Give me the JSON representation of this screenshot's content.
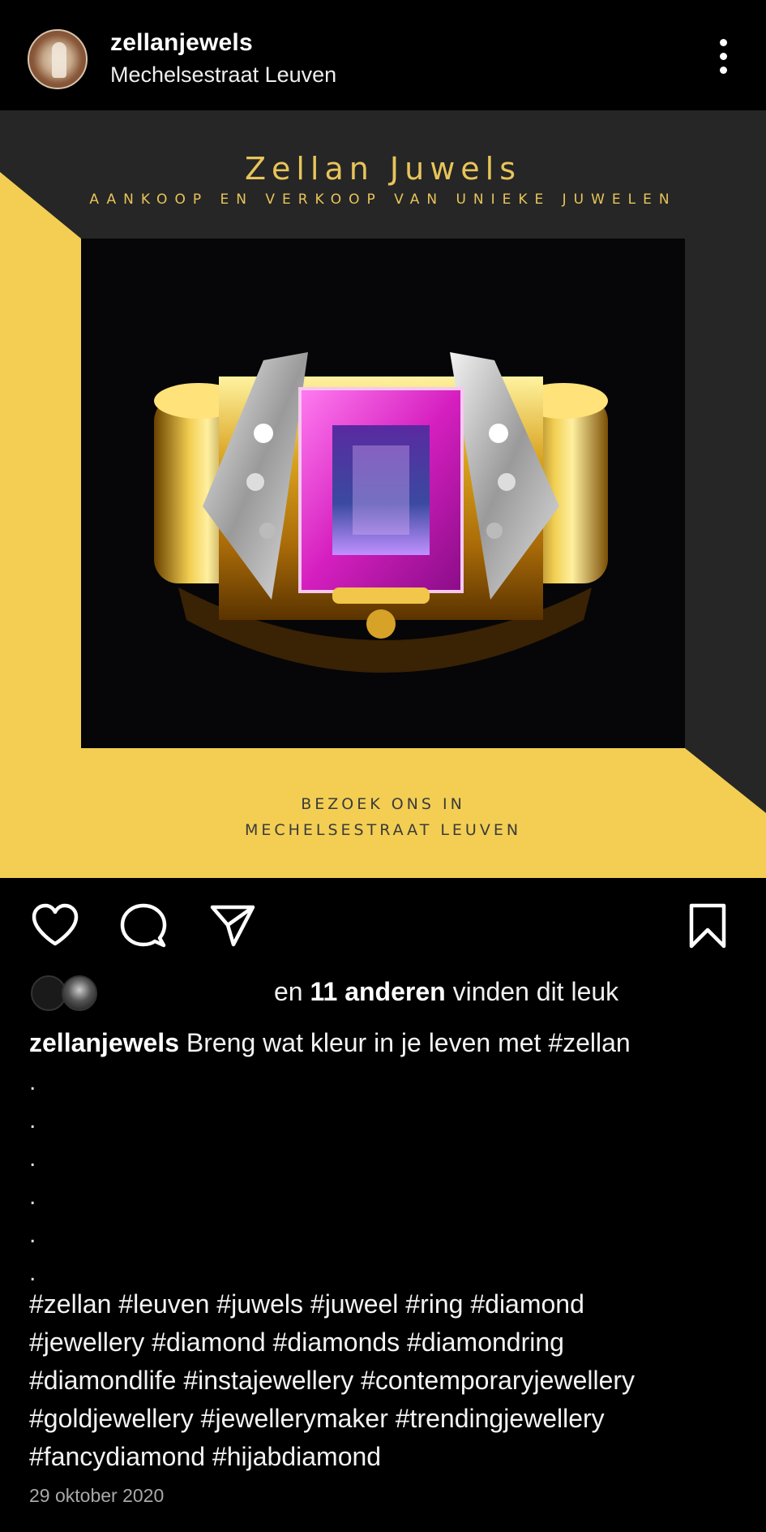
{
  "header": {
    "username": "zellanjewels",
    "location": "Mechelsestraat Leuven",
    "more_icon": "more-vertical-icon"
  },
  "post_image": {
    "brand_title": "Zellan Juwels",
    "brand_subtitle": "AANKOOP EN VERKOOP VAN UNIEKE JUWELEN",
    "visit_line_1": "BEZOEK ONS IN",
    "visit_line_2": "MECHELSESTRAAT LEUVEN",
    "colors": {
      "accent_yellow": "#f3ce52",
      "frame_dark": "#262626",
      "gold_text": "#e8c45a",
      "gem": "#e040c8"
    }
  },
  "actions": {
    "like_icon": "heart-icon",
    "comment_icon": "comment-icon",
    "share_icon": "share-icon",
    "save_icon": "bookmark-icon"
  },
  "likes": {
    "prefix": "en ",
    "count": "11 anderen",
    "suffix": " vinden dit leuk"
  },
  "caption": {
    "username": "zellanjewels",
    "text": " Breng wat kleur in je leven met #zellan",
    "dots": [
      ".",
      ".",
      ".",
      ".",
      ".",
      "."
    ],
    "hashtag_lines": [
      "#zellan #leuven #juwels #juweel #ring #diamond",
      "#jewellery #diamond #diamonds #diamondring",
      "#diamondlife #instajewellery #contemporaryjewellery",
      "#goldjewellery #jewellerymaker #trendingjewellery",
      "#fancydiamond #hijabdiamond"
    ]
  },
  "date": "29 oktober 2020"
}
